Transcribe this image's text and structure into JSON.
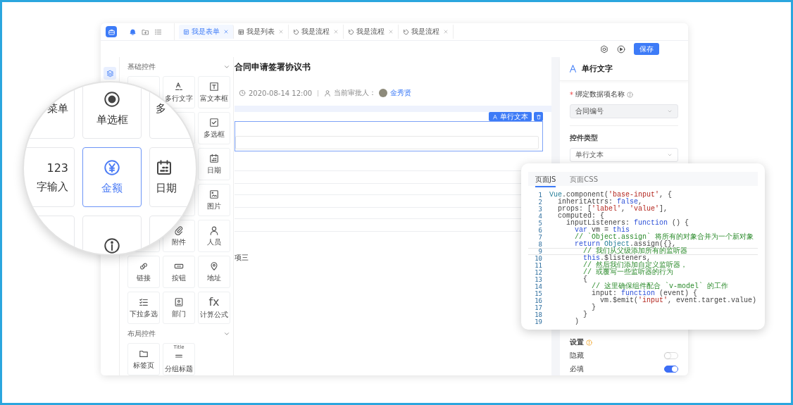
{
  "tabs": [
    {
      "label": "我是表单",
      "kind": "form",
      "selected": true
    },
    {
      "label": "我是列表",
      "kind": "list",
      "selected": false
    },
    {
      "label": "我是流程",
      "kind": "flow",
      "selected": false
    },
    {
      "label": "我是流程",
      "kind": "flow",
      "selected": false
    },
    {
      "label": "我是流程",
      "kind": "flow",
      "selected": false
    }
  ],
  "toolbar": {
    "save_button": "保存"
  },
  "palette": {
    "sections": [
      {
        "title": "基础控件",
        "expanded": true,
        "items": [
          {
            "label": "多行文字"
          },
          {
            "label": "富文本框"
          },
          {
            "label": "多选框"
          },
          {
            "label": "日期"
          },
          {
            "label": "图片"
          },
          {
            "label": "附件"
          },
          {
            "label": "人员"
          },
          {
            "label": "链接"
          },
          {
            "label": "按钮"
          },
          {
            "label": "地址"
          },
          {
            "label": "下拉多选"
          },
          {
            "label": "部门"
          },
          {
            "icon_text": "fx",
            "label": "计算公式"
          }
        ]
      },
      {
        "title": "布局控件",
        "expanded": true,
        "items": [
          {
            "label": "标签页"
          },
          {
            "icon_text": "Title",
            "label": "分组标题"
          }
        ]
      }
    ]
  },
  "magnifier": {
    "items": [
      {
        "label": "菜单",
        "selected": false
      },
      {
        "label": "单选框",
        "selected": false
      },
      {
        "label": "多",
        "selected": false
      },
      {
        "icon_text": "123",
        "label": "字输入",
        "selected": false
      },
      {
        "label": "金额",
        "selected": true
      },
      {
        "label": "日期",
        "selected": false
      },
      {
        "selected": false
      },
      {
        "selected": false
      },
      {
        "selected": false
      }
    ]
  },
  "form": {
    "title": "合同申请签署协议书",
    "date": "2020-08-14 12:00",
    "approver_label": "当前审批人：",
    "approver": "金秀贤",
    "field_tag": "单行文本",
    "tail_text": "项三"
  },
  "properties": {
    "title": "单行文字",
    "fields": [
      {
        "label": "绑定数据项名称",
        "required_mark": "*",
        "has_help": true,
        "disabled": true,
        "value": "合同编号"
      },
      {
        "label": "控件类型",
        "has_help": false,
        "disabled": false,
        "value": "单行文本"
      }
    ],
    "settings_title": "设置",
    "switches": [
      {
        "label": "隐藏",
        "on": false
      },
      {
        "label": "必填",
        "on": true
      }
    ]
  },
  "code_panel": {
    "tabs": [
      {
        "label": "页面JS",
        "selected": true
      },
      {
        "label": "页面CSS",
        "selected": false
      }
    ],
    "lines": [
      {
        "number": "1",
        "current": false,
        "tokens": [
          {
            "kind": "type",
            "text": "Vue"
          },
          {
            "kind": "plain",
            "text": ".component("
          },
          {
            "kind": "string",
            "text": "'base-input'"
          },
          {
            "kind": "plain",
            "text": ", {"
          }
        ]
      },
      {
        "number": "2",
        "current": false,
        "tokens": [
          {
            "kind": "plain",
            "text": "  inheritAttrs: "
          },
          {
            "kind": "keyword",
            "text": "false"
          },
          {
            "kind": "plain",
            "text": ","
          }
        ]
      },
      {
        "number": "3",
        "current": false,
        "tokens": [
          {
            "kind": "plain",
            "text": "  props: ["
          },
          {
            "kind": "string",
            "text": "'label'"
          },
          {
            "kind": "plain",
            "text": ", "
          },
          {
            "kind": "string",
            "text": "'value'"
          },
          {
            "kind": "plain",
            "text": "],"
          }
        ]
      },
      {
        "number": "4",
        "current": false,
        "tokens": [
          {
            "kind": "plain",
            "text": "  computed: {"
          }
        ]
      },
      {
        "number": "5",
        "current": false,
        "tokens": [
          {
            "kind": "plain",
            "text": "    inputListeners: "
          },
          {
            "kind": "keyword",
            "text": "function"
          },
          {
            "kind": "plain",
            "text": " () {"
          }
        ]
      },
      {
        "number": "6",
        "current": false,
        "tokens": [
          {
            "kind": "keyword",
            "text": "      var"
          },
          {
            "kind": "plain",
            "text": " vm = "
          },
          {
            "kind": "keyword",
            "text": "this"
          }
        ]
      },
      {
        "number": "7",
        "current": false,
        "tokens": [
          {
            "kind": "comment",
            "text": "      // `Object.assign` 将所有的对象合并为一个新对象"
          }
        ]
      },
      {
        "number": "8",
        "current": false,
        "tokens": [
          {
            "kind": "keyword",
            "text": "      return"
          },
          {
            "kind": "type",
            "text": " Object"
          },
          {
            "kind": "plain",
            "text": ".assign({},"
          }
        ]
      },
      {
        "number": "9",
        "current": true,
        "tokens": [
          {
            "kind": "comment",
            "text": "        // 我们从父级添加所有的监听器"
          }
        ]
      },
      {
        "number": "10",
        "current": false,
        "tokens": [
          {
            "kind": "keyword",
            "text": "        this"
          },
          {
            "kind": "plain",
            "text": ".$listeners,"
          }
        ]
      },
      {
        "number": "11",
        "current": false,
        "tokens": [
          {
            "kind": "comment",
            "text": "        // 然后我们添加自定义监听器，"
          }
        ]
      },
      {
        "number": "12",
        "current": false,
        "tokens": [
          {
            "kind": "comment",
            "text": "        // 或覆写一些监听器的行为"
          }
        ]
      },
      {
        "number": "13",
        "current": false,
        "tokens": [
          {
            "kind": "plain",
            "text": "        {"
          }
        ]
      },
      {
        "number": "14",
        "current": false,
        "tokens": [
          {
            "kind": "comment",
            "text": "          // 这里确保组件配合 `v-model` 的工作"
          }
        ]
      },
      {
        "number": "15",
        "current": false,
        "tokens": [
          {
            "kind": "plain",
            "text": "          input: "
          },
          {
            "kind": "keyword",
            "text": "function"
          },
          {
            "kind": "plain",
            "text": " (event) {"
          }
        ]
      },
      {
        "number": "16",
        "current": false,
        "tokens": [
          {
            "kind": "plain",
            "text": "            vm.$emit("
          },
          {
            "kind": "string",
            "text": "'input'"
          },
          {
            "kind": "plain",
            "text": ", event.target.value)"
          }
        ]
      },
      {
        "number": "17",
        "current": false,
        "tokens": [
          {
            "kind": "plain",
            "text": "          }"
          }
        ]
      },
      {
        "number": "18",
        "current": false,
        "tokens": [
          {
            "kind": "plain",
            "text": "        }"
          }
        ]
      },
      {
        "number": "19",
        "current": false,
        "tokens": [
          {
            "kind": "plain",
            "text": "      )"
          }
        ]
      }
    ]
  }
}
